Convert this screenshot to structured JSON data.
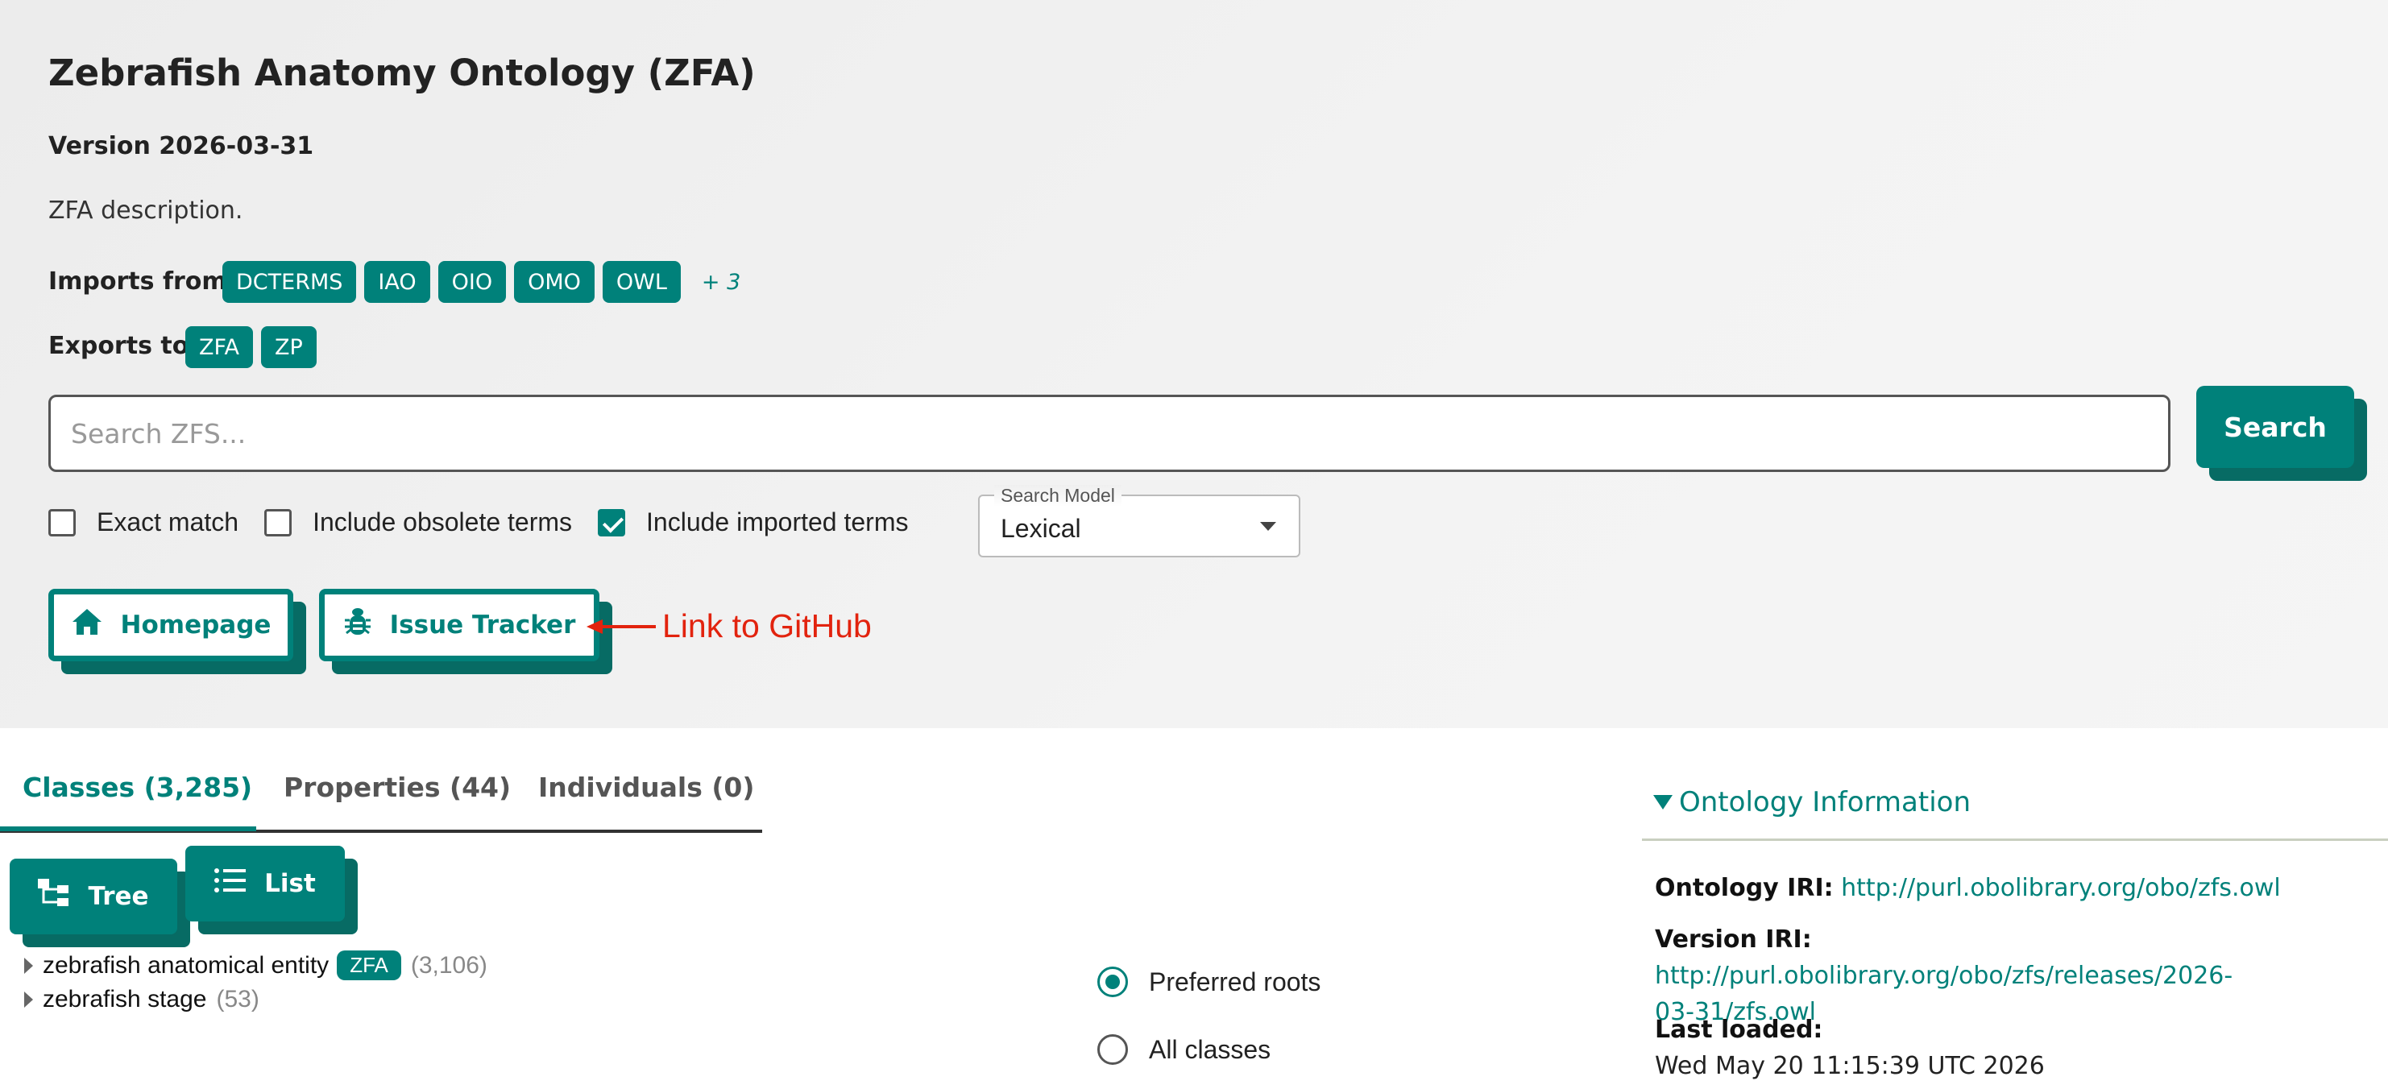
{
  "header": {
    "title": "Zebrafish Anatomy Ontology (ZFA)",
    "version": "Version 2026-03-31",
    "description": "ZFA description.",
    "imports_label": "Imports from",
    "imports": [
      "DCTERMS",
      "IAO",
      "OIO",
      "OMO",
      "OWL"
    ],
    "imports_more": "+ 3",
    "exports_label": "Exports to",
    "exports": [
      "ZFA",
      "ZP"
    ]
  },
  "search": {
    "placeholder": "Search ZFS...",
    "button_label": "Search",
    "options": [
      {
        "label": "Exact match",
        "checked": false
      },
      {
        "label": "Include obsolete terms",
        "checked": false
      },
      {
        "label": "Include imported terms",
        "checked": true
      }
    ],
    "model_label": "Search Model",
    "model_value": "Lexical"
  },
  "links": {
    "homepage_label": "Homepage",
    "homepage_icon": "home-icon",
    "issue_tracker_label": "Issue Tracker",
    "issue_tracker_icon": "bug-icon"
  },
  "annotation": {
    "text": "Link to GitHub",
    "color": "#e2230e"
  },
  "tabs": [
    {
      "label": "Classes (3,285)",
      "active": true
    },
    {
      "label": "Properties (44)",
      "active": false
    },
    {
      "label": "Individuals (0)",
      "active": false
    }
  ],
  "view": {
    "tree_label": "Tree",
    "list_label": "List"
  },
  "tree": [
    {
      "label": "zebrafish anatomical entity",
      "tag": "ZFA",
      "count": "(3,106)"
    },
    {
      "label": "zebrafish stage",
      "tag": "",
      "count": "(53)"
    }
  ],
  "roots": {
    "preferred": "Preferred roots",
    "all": "All classes",
    "selected": "preferred"
  },
  "ontology_info": {
    "heading": "Ontology Information",
    "iri_label": "Ontology IRI:",
    "iri": "http://purl.obolibrary.org/obo/zfs.owl",
    "version_iri_label": "Version IRI:",
    "version_iri_line1": "http://purl.obolibrary.org/obo/zfs/releases/2026-",
    "version_iri_line2": "03-31/zfs.owl",
    "last_loaded_label": "Last loaded:",
    "last_loaded": "Wed May 20 11:15:39 UTC 2026"
  },
  "colors": {
    "accent": "#00817a",
    "accent_shadow": "#076b64"
  }
}
